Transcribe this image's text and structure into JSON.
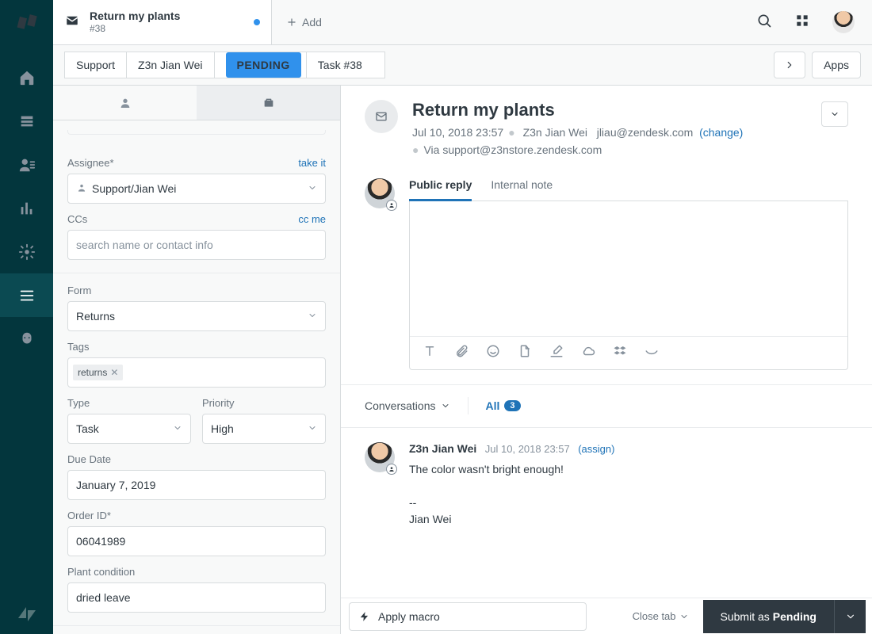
{
  "tab": {
    "title": "Return my plants",
    "sub": "#38",
    "add_label": "Add"
  },
  "topbar": {
    "apps_label": "Apps"
  },
  "breadcrumb": {
    "seg1": "Support",
    "seg2": "Z3n Jian Wei",
    "status": "PENDING",
    "task": "Task #38"
  },
  "props": {
    "assignee_label": "Assignee*",
    "take_it": "take it",
    "assignee_value": "Support/Jian Wei",
    "ccs_label": "CCs",
    "cc_me": "cc me",
    "ccs_placeholder": "search name or contact info",
    "form_label": "Form",
    "form_value": "Returns",
    "tags_label": "Tags",
    "tag1": "returns",
    "type_label": "Type",
    "type_value": "Task",
    "priority_label": "Priority",
    "priority_value": "High",
    "due_label": "Due Date",
    "due_value": "January 7, 2019",
    "orderid_label": "Order ID*",
    "orderid_value": "06041989",
    "plant_label": "Plant condition",
    "plant_value": "dried leave"
  },
  "ticket": {
    "title": "Return my plants",
    "date": "Jul 10, 2018 23:57",
    "requester": "Z3n Jian Wei",
    "email": "jliau@zendesk.com",
    "change": "(change)",
    "via": "Via support@z3nstore.zendesk.com"
  },
  "reply": {
    "tab_public": "Public reply",
    "tab_internal": "Internal note"
  },
  "convfilter": {
    "conversations": "Conversations",
    "all": "All",
    "count": "3"
  },
  "msg1": {
    "who": "Z3n Jian Wei",
    "when": "Jul 10, 2018 23:57",
    "assign": "(assign)",
    "line1": "The color wasn't bright enough!",
    "line2": "--",
    "line3": "Jian Wei"
  },
  "footer": {
    "macro": "Apply macro",
    "close": "Close tab",
    "submit_pre": "Submit as",
    "submit_status": "Pending"
  }
}
